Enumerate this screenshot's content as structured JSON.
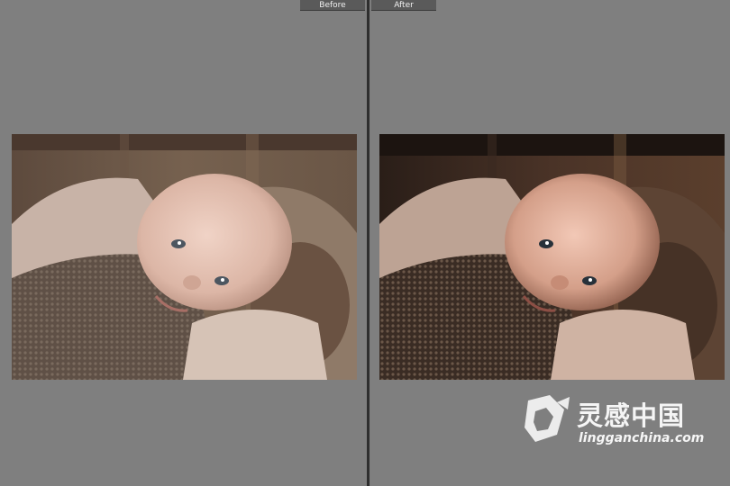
{
  "compare_view": {
    "before_label": "Before",
    "after_label": "After"
  },
  "photo": {
    "subject": "newborn baby photo",
    "before_alt": "Before edit",
    "after_alt": "After edit"
  },
  "watermark": {
    "brand_cn": "灵感中国",
    "url": "lingganchina.com"
  },
  "colors": {
    "background": "#7f7f7f",
    "divider": "#2e2e2e",
    "tab": "#5a5a5a"
  }
}
